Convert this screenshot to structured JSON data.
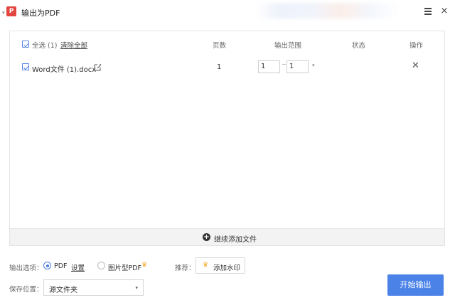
{
  "window": {
    "title": "输出为PDF",
    "logo_letter": "P",
    "marker": "▾",
    "close_glyph": "×"
  },
  "table": {
    "select_all_label": "全选 (1)",
    "clear_all_label": "清除全部",
    "columns": [
      "页数",
      "输出范围",
      "状态",
      "操作"
    ],
    "rows": [
      {
        "checked": true,
        "file_name": "Word文件 (1).docx",
        "pages": "1",
        "range_from": "1",
        "range_sep": "~",
        "range_to": "1",
        "range_dropdown": "▾",
        "status": "",
        "delete_glyph": "✕"
      }
    ]
  },
  "add_more": {
    "icon": "+",
    "label": "继续添加文件"
  },
  "options": {
    "label": "输出选项：",
    "pdf_label": "PDF",
    "settings_label": "设置",
    "image_pdf_label": "图片型PDF",
    "selected": "PDF",
    "crown_glyph": "♛"
  },
  "recommend": {
    "label": "推荐：",
    "watermark_label": "添加水印"
  },
  "save": {
    "label": "保存位置：",
    "selected": "源文件夹",
    "arrow": "▾"
  },
  "start_button_label": "开始输出",
  "colors": {
    "accent": "#4a82e8",
    "logo": "#e2463e",
    "crown": "#f5a623"
  }
}
